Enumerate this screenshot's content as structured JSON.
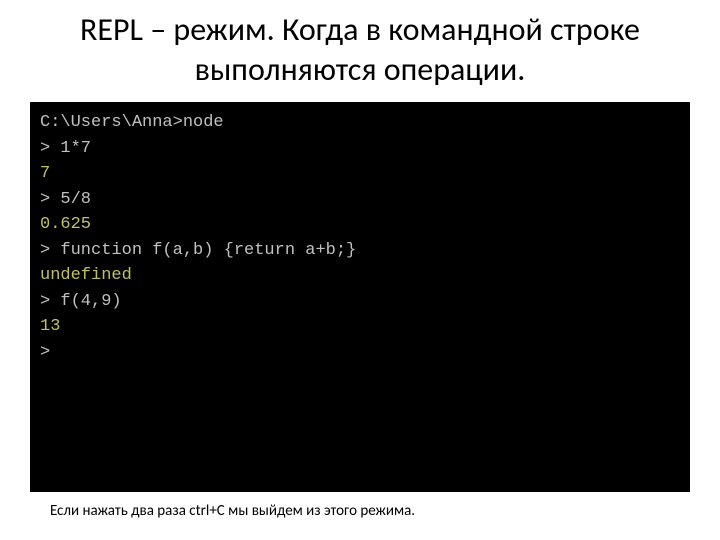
{
  "title": "REPL – режим. Когда в командной строке выполняются операции.",
  "terminal": {
    "line1_prompt": "C:\\Users\\Anna>node",
    "line2": "> 1*7",
    "line3": "7",
    "line4": "> 5/8",
    "line5": "0.625",
    "line6": "> function f(a,b) {return a+b;}",
    "line7": "undefined",
    "line8": "> f(4,9)",
    "line9": "13",
    "line10": ">"
  },
  "footer": "Если нажать два раза ctrl+C  мы выйдем из этого режима."
}
